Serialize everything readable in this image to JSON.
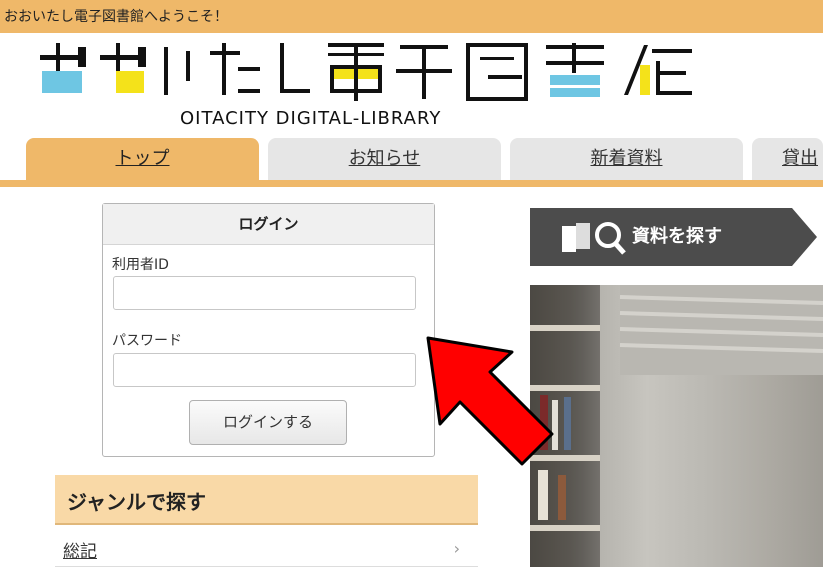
{
  "header": {
    "welcome": "おおいたし電子図書館へようこそ！"
  },
  "logo": {
    "title": "おおいたし電子図書館",
    "subtitle": "OITACITY DIGITAL-LIBRARY"
  },
  "tabs": [
    {
      "label": "トップ",
      "active": true
    },
    {
      "label": "お知らせ",
      "active": false
    },
    {
      "label": "新着資料",
      "active": false
    },
    {
      "label": "貸出",
      "active": false
    }
  ],
  "login": {
    "title": "ログイン",
    "user_id_label": "利用者ID",
    "user_id_value": "",
    "password_label": "パスワード",
    "password_value": "",
    "submit_label": "ログインする"
  },
  "search_banner": {
    "label": "資料を探す",
    "icon": "book-search-icon"
  },
  "genre": {
    "title": "ジャンルで探す",
    "items": [
      {
        "label": "総記"
      }
    ]
  },
  "annotation": {
    "icon": "red-arrow-icon",
    "color": "#ff0000"
  },
  "colors": {
    "accent": "#efb869",
    "genre_bg": "#f9d9a7",
    "banner": "#4c4c4c"
  }
}
